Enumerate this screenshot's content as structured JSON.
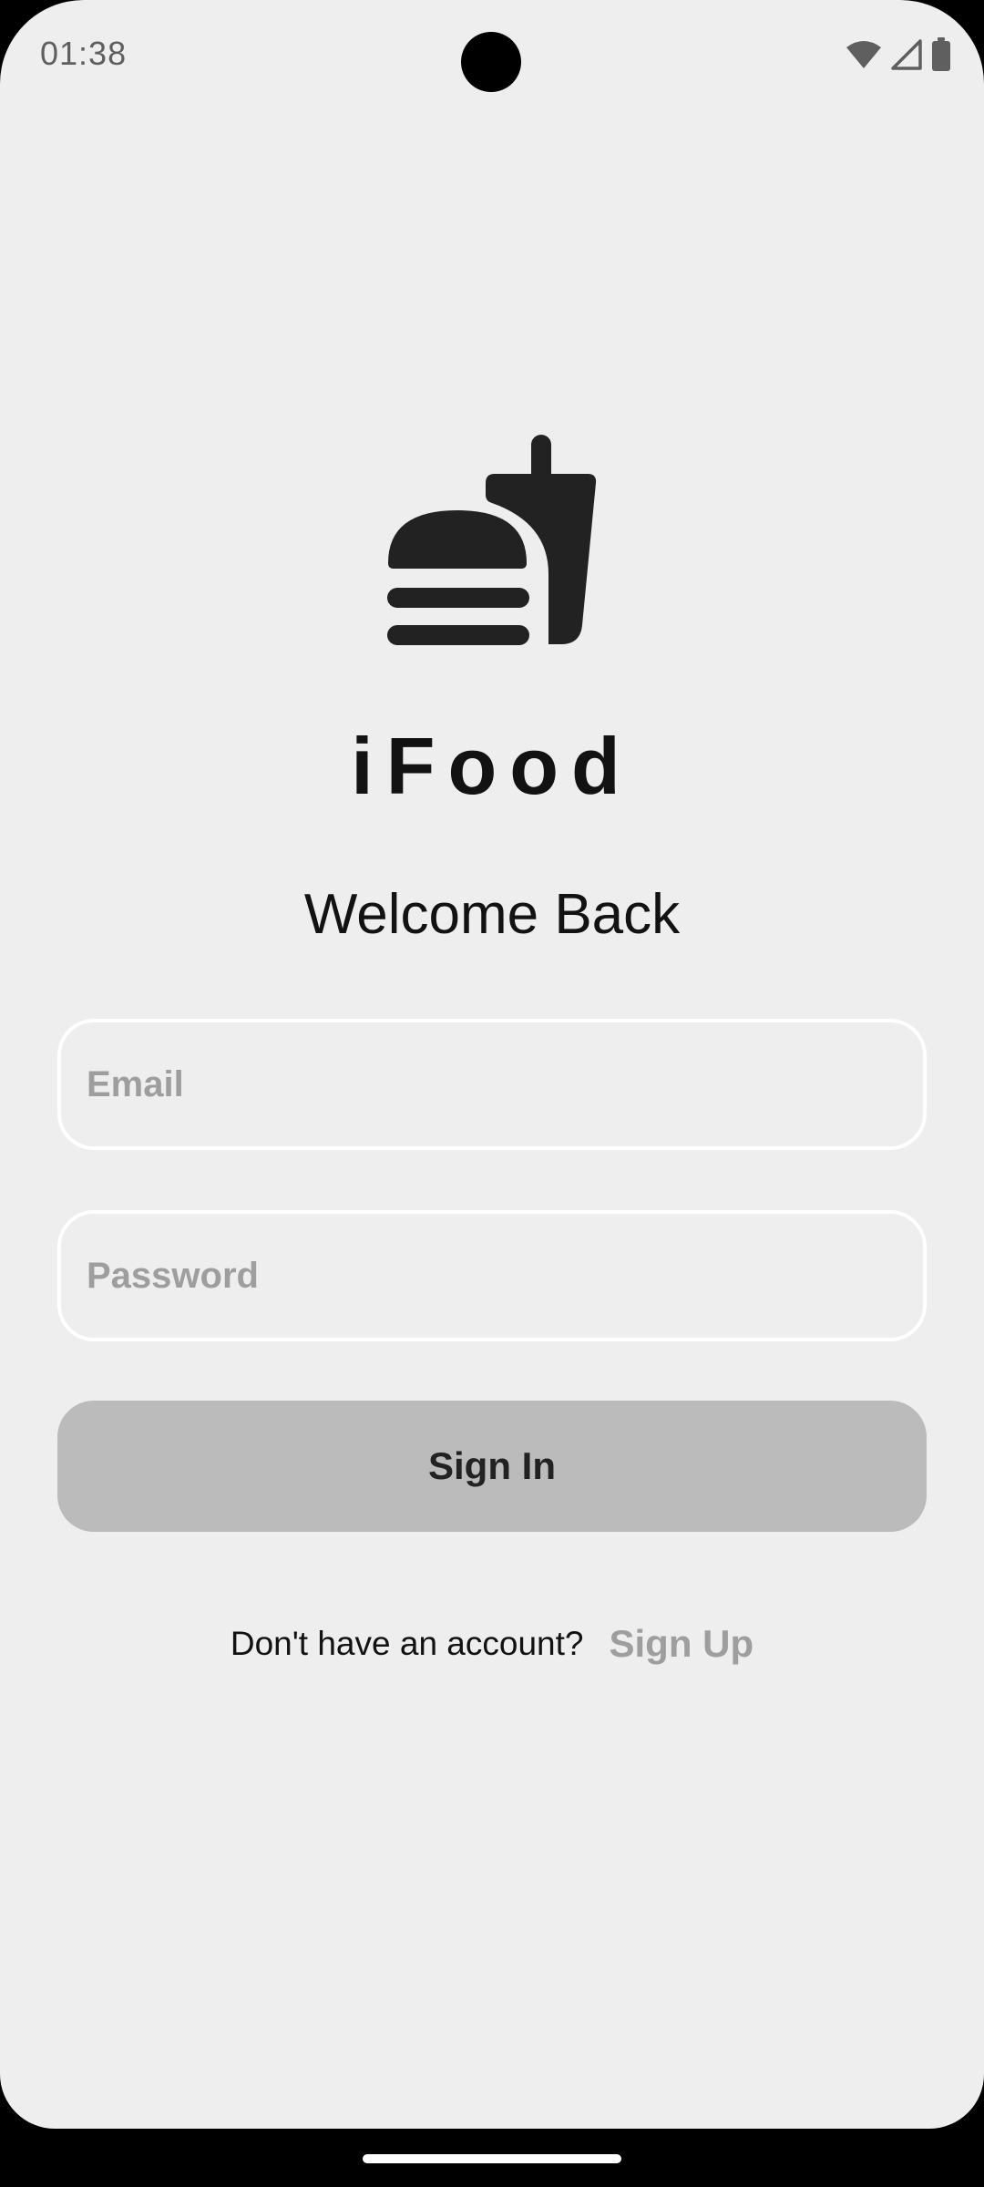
{
  "status_bar": {
    "time": "01:38",
    "icons": [
      "wifi-icon",
      "cellular-signal-icon",
      "battery-icon"
    ]
  },
  "logo": {
    "icon": "burger-and-drink-icon",
    "color": "#222222"
  },
  "brand": {
    "title": "iFood"
  },
  "login": {
    "heading": "Welcome Back",
    "email_placeholder": "Email",
    "email_value": "",
    "password_placeholder": "Password",
    "password_value": "",
    "signin_label": "Sign In",
    "signup_prompt": "Don't have an account?",
    "signup_label": "Sign Up"
  },
  "colors": {
    "background": "#eeeeee",
    "button": "#bbbbbb",
    "muted_text": "#9e9e9e"
  }
}
